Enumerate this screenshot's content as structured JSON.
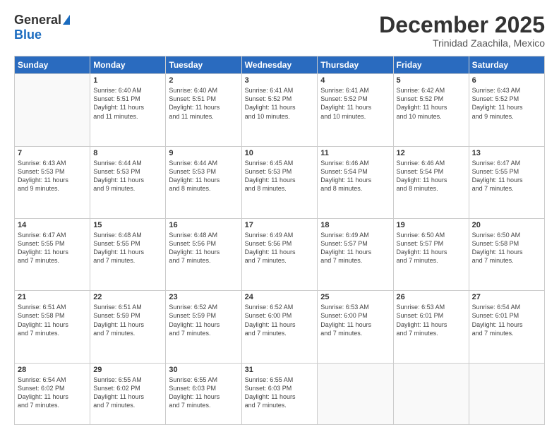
{
  "logo": {
    "general": "General",
    "blue": "Blue"
  },
  "title": {
    "month": "December 2025",
    "location": "Trinidad Zaachila, Mexico"
  },
  "headers": [
    "Sunday",
    "Monday",
    "Tuesday",
    "Wednesday",
    "Thursday",
    "Friday",
    "Saturday"
  ],
  "weeks": [
    [
      {
        "day": "",
        "info": ""
      },
      {
        "day": "1",
        "info": "Sunrise: 6:40 AM\nSunset: 5:51 PM\nDaylight: 11 hours\nand 11 minutes."
      },
      {
        "day": "2",
        "info": "Sunrise: 6:40 AM\nSunset: 5:51 PM\nDaylight: 11 hours\nand 11 minutes."
      },
      {
        "day": "3",
        "info": "Sunrise: 6:41 AM\nSunset: 5:52 PM\nDaylight: 11 hours\nand 10 minutes."
      },
      {
        "day": "4",
        "info": "Sunrise: 6:41 AM\nSunset: 5:52 PM\nDaylight: 11 hours\nand 10 minutes."
      },
      {
        "day": "5",
        "info": "Sunrise: 6:42 AM\nSunset: 5:52 PM\nDaylight: 11 hours\nand 10 minutes."
      },
      {
        "day": "6",
        "info": "Sunrise: 6:43 AM\nSunset: 5:52 PM\nDaylight: 11 hours\nand 9 minutes."
      }
    ],
    [
      {
        "day": "7",
        "info": "Sunrise: 6:43 AM\nSunset: 5:53 PM\nDaylight: 11 hours\nand 9 minutes."
      },
      {
        "day": "8",
        "info": "Sunrise: 6:44 AM\nSunset: 5:53 PM\nDaylight: 11 hours\nand 9 minutes."
      },
      {
        "day": "9",
        "info": "Sunrise: 6:44 AM\nSunset: 5:53 PM\nDaylight: 11 hours\nand 8 minutes."
      },
      {
        "day": "10",
        "info": "Sunrise: 6:45 AM\nSunset: 5:53 PM\nDaylight: 11 hours\nand 8 minutes."
      },
      {
        "day": "11",
        "info": "Sunrise: 6:46 AM\nSunset: 5:54 PM\nDaylight: 11 hours\nand 8 minutes."
      },
      {
        "day": "12",
        "info": "Sunrise: 6:46 AM\nSunset: 5:54 PM\nDaylight: 11 hours\nand 8 minutes."
      },
      {
        "day": "13",
        "info": "Sunrise: 6:47 AM\nSunset: 5:55 PM\nDaylight: 11 hours\nand 7 minutes."
      }
    ],
    [
      {
        "day": "14",
        "info": "Sunrise: 6:47 AM\nSunset: 5:55 PM\nDaylight: 11 hours\nand 7 minutes."
      },
      {
        "day": "15",
        "info": "Sunrise: 6:48 AM\nSunset: 5:55 PM\nDaylight: 11 hours\nand 7 minutes."
      },
      {
        "day": "16",
        "info": "Sunrise: 6:48 AM\nSunset: 5:56 PM\nDaylight: 11 hours\nand 7 minutes."
      },
      {
        "day": "17",
        "info": "Sunrise: 6:49 AM\nSunset: 5:56 PM\nDaylight: 11 hours\nand 7 minutes."
      },
      {
        "day": "18",
        "info": "Sunrise: 6:49 AM\nSunset: 5:57 PM\nDaylight: 11 hours\nand 7 minutes."
      },
      {
        "day": "19",
        "info": "Sunrise: 6:50 AM\nSunset: 5:57 PM\nDaylight: 11 hours\nand 7 minutes."
      },
      {
        "day": "20",
        "info": "Sunrise: 6:50 AM\nSunset: 5:58 PM\nDaylight: 11 hours\nand 7 minutes."
      }
    ],
    [
      {
        "day": "21",
        "info": "Sunrise: 6:51 AM\nSunset: 5:58 PM\nDaylight: 11 hours\nand 7 minutes."
      },
      {
        "day": "22",
        "info": "Sunrise: 6:51 AM\nSunset: 5:59 PM\nDaylight: 11 hours\nand 7 minutes."
      },
      {
        "day": "23",
        "info": "Sunrise: 6:52 AM\nSunset: 5:59 PM\nDaylight: 11 hours\nand 7 minutes."
      },
      {
        "day": "24",
        "info": "Sunrise: 6:52 AM\nSunset: 6:00 PM\nDaylight: 11 hours\nand 7 minutes."
      },
      {
        "day": "25",
        "info": "Sunrise: 6:53 AM\nSunset: 6:00 PM\nDaylight: 11 hours\nand 7 minutes."
      },
      {
        "day": "26",
        "info": "Sunrise: 6:53 AM\nSunset: 6:01 PM\nDaylight: 11 hours\nand 7 minutes."
      },
      {
        "day": "27",
        "info": "Sunrise: 6:54 AM\nSunset: 6:01 PM\nDaylight: 11 hours\nand 7 minutes."
      }
    ],
    [
      {
        "day": "28",
        "info": "Sunrise: 6:54 AM\nSunset: 6:02 PM\nDaylight: 11 hours\nand 7 minutes."
      },
      {
        "day": "29",
        "info": "Sunrise: 6:55 AM\nSunset: 6:02 PM\nDaylight: 11 hours\nand 7 minutes."
      },
      {
        "day": "30",
        "info": "Sunrise: 6:55 AM\nSunset: 6:03 PM\nDaylight: 11 hours\nand 7 minutes."
      },
      {
        "day": "31",
        "info": "Sunrise: 6:55 AM\nSunset: 6:03 PM\nDaylight: 11 hours\nand 7 minutes."
      },
      {
        "day": "",
        "info": ""
      },
      {
        "day": "",
        "info": ""
      },
      {
        "day": "",
        "info": ""
      }
    ]
  ]
}
